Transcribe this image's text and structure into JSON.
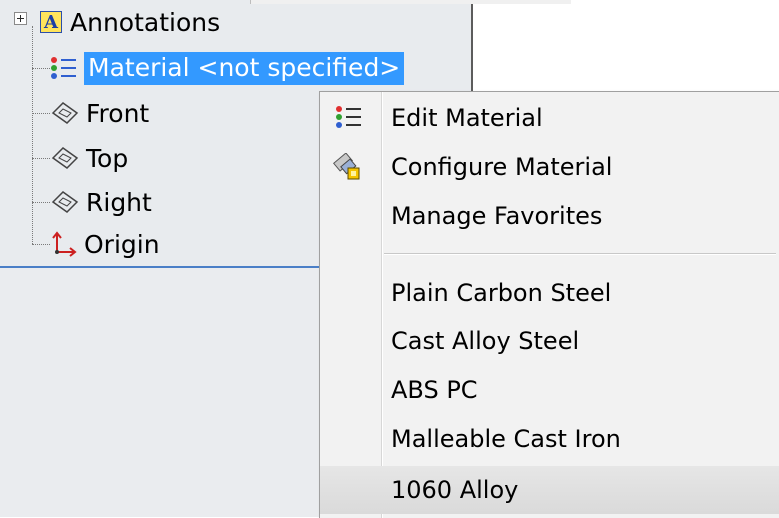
{
  "tree": {
    "items": [
      {
        "label": "Annotations",
        "icon": "annotations-icon"
      },
      {
        "label": "Material <not specified>",
        "icon": "material-icon",
        "selected": true
      },
      {
        "label": "Front",
        "icon": "plane-icon"
      },
      {
        "label": "Top",
        "icon": "plane-icon"
      },
      {
        "label": "Right",
        "icon": "plane-icon"
      },
      {
        "label": "Origin",
        "icon": "origin-icon"
      }
    ],
    "annotation_glyph": "A",
    "selection_color": "#3399ff"
  },
  "context_menu": {
    "items": [
      {
        "label": "Edit Material",
        "icon": "material-icon"
      },
      {
        "label": "Configure Material",
        "icon": "configure-material-icon"
      },
      {
        "label": "Manage Favorites",
        "icon": ""
      },
      {
        "label": "Plain Carbon Steel",
        "icon": ""
      },
      {
        "label": "Cast Alloy Steel",
        "icon": ""
      },
      {
        "label": "ABS PC",
        "icon": ""
      },
      {
        "label": "Malleable Cast Iron",
        "icon": ""
      },
      {
        "label": "1060 Alloy",
        "icon": "",
        "hovered": true
      }
    ]
  }
}
